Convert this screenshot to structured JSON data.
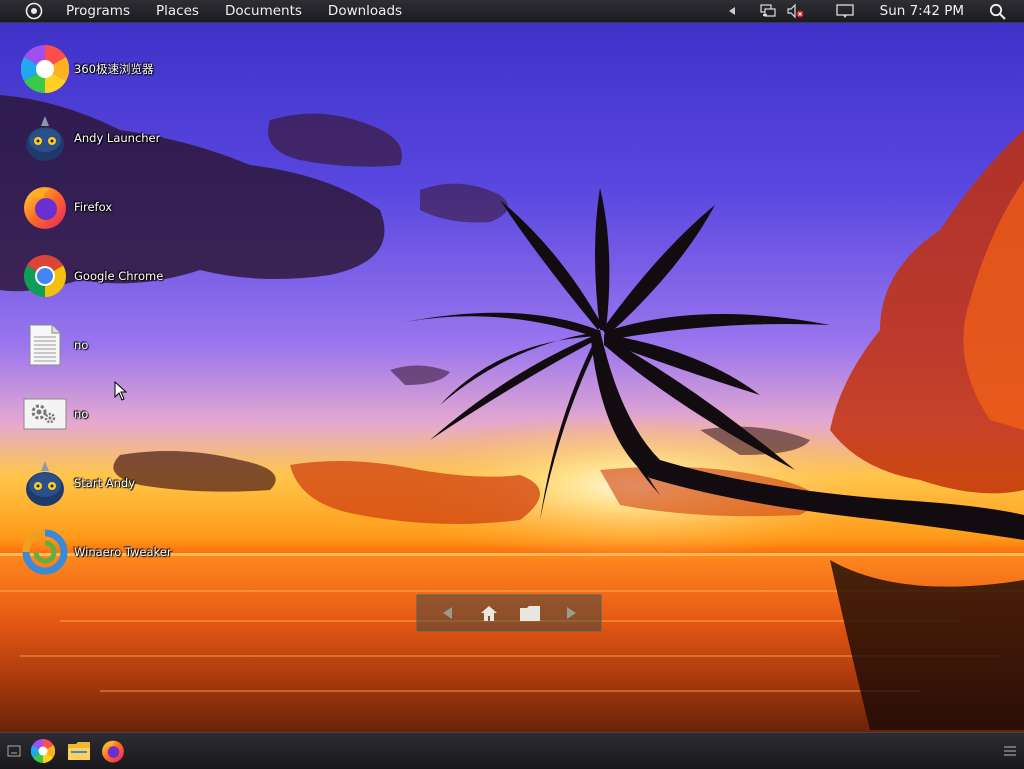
{
  "top_panel": {
    "menus": [
      "Programs",
      "Places",
      "Documents",
      "Downloads"
    ],
    "clock": "Sun 7:42 PM"
  },
  "desktop_icons": [
    {
      "label": "360极速浏览器",
      "icon": "360-browser-icon"
    },
    {
      "label": "Andy Launcher",
      "icon": "andy-robot-icon"
    },
    {
      "label": "Firefox",
      "icon": "firefox-icon"
    },
    {
      "label": "Google Chrome",
      "icon": "chrome-icon"
    },
    {
      "label": "no",
      "icon": "text-document-icon"
    },
    {
      "label": "no",
      "icon": "settings-file-icon"
    },
    {
      "label": "Start Andy",
      "icon": "andy-robot-icon"
    },
    {
      "label": "Winaero Tweaker",
      "icon": "winaero-tweaker-icon"
    }
  ],
  "nav_widget": {
    "buttons": [
      "back-arrow-icon",
      "home-icon",
      "folder-icon",
      "forward-arrow-icon"
    ]
  },
  "taskbar": {
    "items": [
      "show-desktop-icon",
      "360-browser-icon",
      "file-manager-icon",
      "firefox-icon",
      "menu-icon"
    ]
  },
  "colors": {
    "panel_bg": "#1b1b20",
    "sky_top": "#4a3fd0",
    "sunset_orange": "#ff8c1a"
  }
}
